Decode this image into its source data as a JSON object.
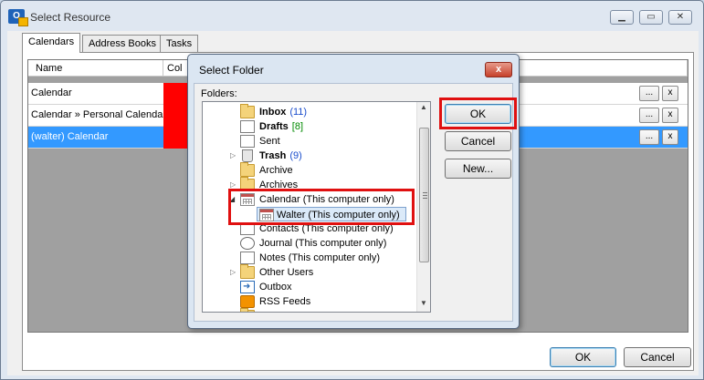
{
  "window": {
    "title": "Select Resource",
    "app_icon": "outlook-icon",
    "caption_buttons": [
      "minimize",
      "maximize",
      "close"
    ]
  },
  "tabs": [
    {
      "label": "Calendars",
      "active": true
    },
    {
      "label": "Address Books",
      "active": false
    },
    {
      "label": "Tasks",
      "active": false
    }
  ],
  "grid": {
    "headers": [
      "Name",
      "Col"
    ],
    "rows": [
      {
        "name": "Calendar",
        "color": "#ff0000",
        "selected": false
      },
      {
        "name": "Calendar » Personal Calendar",
        "color": "#ff0000",
        "selected": false
      },
      {
        "name": "(walter) Calendar",
        "color": "#ff0000",
        "selected": true
      }
    ],
    "row_buttons": {
      "browse": "...",
      "remove": "x"
    }
  },
  "footer": {
    "ok": "OK",
    "cancel": "Cancel"
  },
  "dialog": {
    "title": "Select Folder",
    "close_glyph": "x",
    "folders_label": "Folders:",
    "buttons": {
      "ok": "OK",
      "cancel": "Cancel",
      "new": "New..."
    },
    "tree": [
      {
        "label": "Inbox",
        "count": "(11)",
        "bold": true,
        "icon": "inbox-icon"
      },
      {
        "label": "Drafts",
        "count": "[8]",
        "bold": true,
        "icon": "drafts-icon"
      },
      {
        "label": "Sent",
        "count": "",
        "bold": false,
        "icon": "sent-icon"
      },
      {
        "label": "Trash",
        "count": "(9)",
        "bold": true,
        "icon": "trash-icon",
        "collapsed": true
      },
      {
        "label": "Archive",
        "count": "",
        "bold": false,
        "icon": "folder-icon"
      },
      {
        "label": "Archives",
        "count": "",
        "bold": false,
        "icon": "folder-icon",
        "collapsed": true
      },
      {
        "label": "Calendar (This computer only)",
        "count": "",
        "bold": false,
        "icon": "calendar-icon",
        "expanded": true
      },
      {
        "label": "Walter (This computer only)",
        "count": "",
        "bold": false,
        "icon": "calendar-icon",
        "selected": true
      },
      {
        "label": "Contacts (This computer only)",
        "count": "",
        "bold": false,
        "icon": "contacts-icon"
      },
      {
        "label": "Journal (This computer only)",
        "count": "",
        "bold": false,
        "icon": "journal-icon"
      },
      {
        "label": "Notes (This computer only)",
        "count": "",
        "bold": false,
        "icon": "notes-icon"
      },
      {
        "label": "Other Users",
        "count": "",
        "bold": false,
        "icon": "folder-icon",
        "collapsed": true
      },
      {
        "label": "Outbox",
        "count": "",
        "bold": false,
        "icon": "outbox-icon"
      },
      {
        "label": "RSS Feeds",
        "count": "",
        "bold": false,
        "icon": "rss-icon"
      }
    ],
    "highlight_color": "#e01010"
  }
}
